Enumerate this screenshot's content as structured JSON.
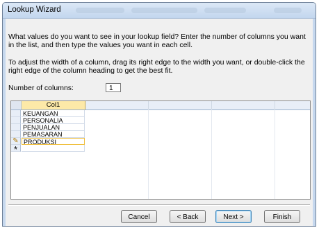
{
  "window": {
    "title": "Lookup Wizard"
  },
  "instructions": {
    "line1a": "What values do you want to see in your lookup field? Enter the number of columns you want",
    "line1b": "in the list, and then type the values you want in each cell.",
    "line2a": "To adjust the width of a column, drag its right edge to the width you want, or double-click the",
    "line2b": "right edge of the column heading to get the best fit."
  },
  "columns_field": {
    "label": "Number of columns:",
    "value": "1"
  },
  "grid": {
    "header": "Col1",
    "rows": [
      {
        "marker": "",
        "value": "KEUANGAN"
      },
      {
        "marker": "",
        "value": "PERSONALIA"
      },
      {
        "marker": "",
        "value": "PENJUALAN"
      },
      {
        "marker": "",
        "value": "PEMASARAN"
      },
      {
        "marker": "✎",
        "value": "PRODUKSI"
      },
      {
        "marker": "*",
        "value": ""
      }
    ]
  },
  "buttons": {
    "cancel": "Cancel",
    "back": "< Back",
    "next": "Next >",
    "finish": "Finish"
  }
}
